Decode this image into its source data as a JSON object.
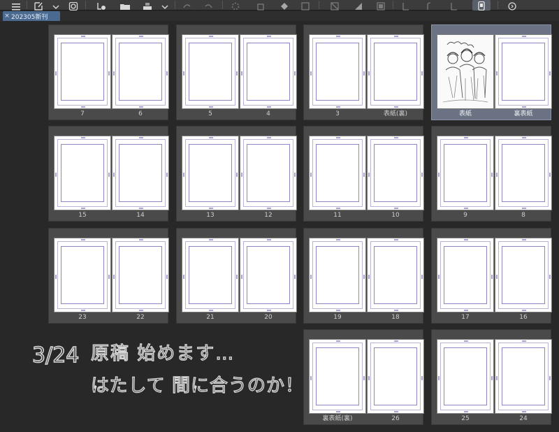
{
  "tab": {
    "title": "202305新刊",
    "close": "×"
  },
  "toolbar": {
    "icons": [
      "menu-icon",
      "new-file-icon",
      "dropdown-icon",
      "layer-icon",
      "add-page-icon",
      "open-folder-icon",
      "save-icon",
      "dropdown-icon",
      "undo-icon",
      "redo-icon",
      "loading-icon",
      "copy-icon",
      "fill-icon",
      "transform-icon",
      "clear-icon",
      "mask-icon",
      "print-icon",
      "pen-icon",
      "rotate-icon",
      "rotate-right-icon",
      "device-icon",
      "chat-icon"
    ],
    "colors": {
      "bar": "#3c3c3c",
      "active": "#5a5f6a",
      "tab": "#4b6a8f",
      "canvas": "#282828"
    }
  },
  "spreads": [
    {
      "left": "7",
      "right": "6"
    },
    {
      "left": "5",
      "right": "4"
    },
    {
      "left": "3",
      "right": "表紙(裏)"
    },
    {
      "left": "表紙",
      "right": "裏表紙",
      "selected": true
    },
    {
      "left": "15",
      "right": "14"
    },
    {
      "left": "13",
      "right": "12"
    },
    {
      "left": "11",
      "right": "10"
    },
    {
      "left": "9",
      "right": "8"
    },
    {
      "left": "23",
      "right": "22"
    },
    {
      "left": "21",
      "right": "20"
    },
    {
      "left": "19",
      "right": "18"
    },
    {
      "left": "17",
      "right": "16"
    },
    {
      "left": "裏表紙(裏)",
      "right": "26"
    },
    {
      "left": "25",
      "right": "24"
    }
  ],
  "note": {
    "date": "3/24",
    "line1": "原稿 始めます…",
    "line2": "はたして 間に合うのか！？"
  }
}
